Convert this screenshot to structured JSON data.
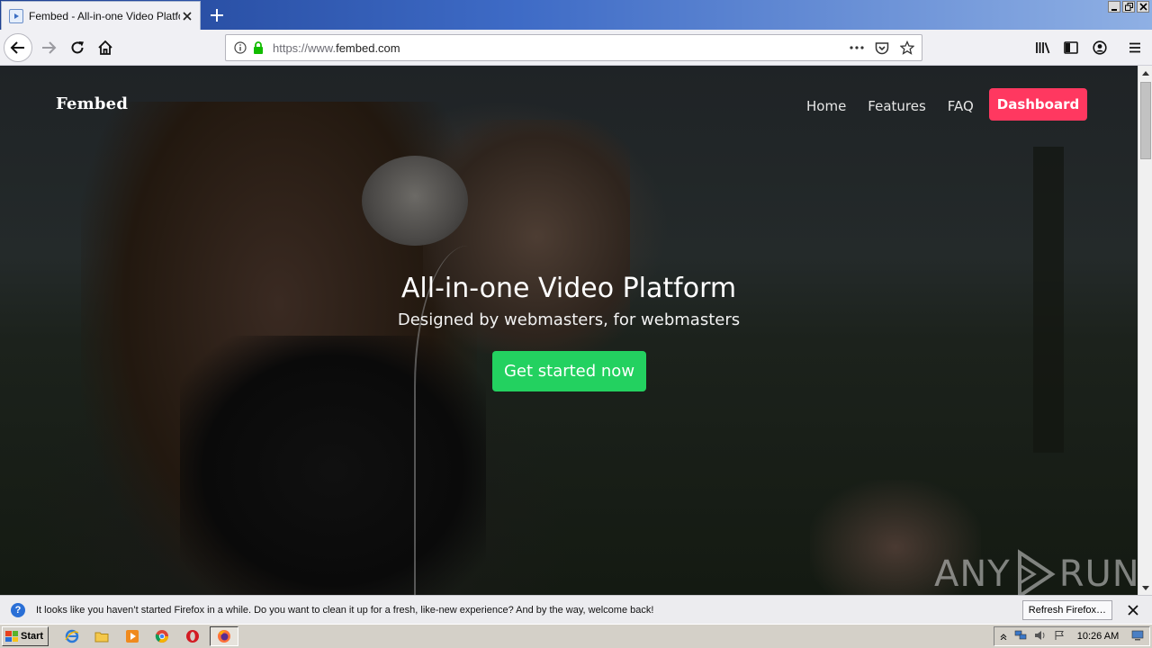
{
  "browser": {
    "tab_title": "Fembed - All-in-one Video Platform",
    "url_scheme": "https://www.",
    "url_host": "fembed.com"
  },
  "site": {
    "logo": "Fembed",
    "nav": [
      "Home",
      "Features",
      "FAQ"
    ],
    "dashboard_label": "Dashboard",
    "hero_title": "All-in-one Video Platform",
    "hero_subtitle": "Designed by webmasters, for webmasters",
    "cta_label": "Get started now"
  },
  "watermark": {
    "left": "ANY",
    "right": "RUN"
  },
  "notification": {
    "text": "It looks like you haven’t started Firefox in a while. Do you want to clean it up for a fresh, like-new experience? And by the way, welcome back!",
    "button_label": "Refresh Firefox…"
  },
  "taskbar": {
    "start_label": "Start",
    "clock": "10:26 AM"
  },
  "colors": {
    "dashboard_button": "#ff3860",
    "cta_button": "#23d160"
  }
}
